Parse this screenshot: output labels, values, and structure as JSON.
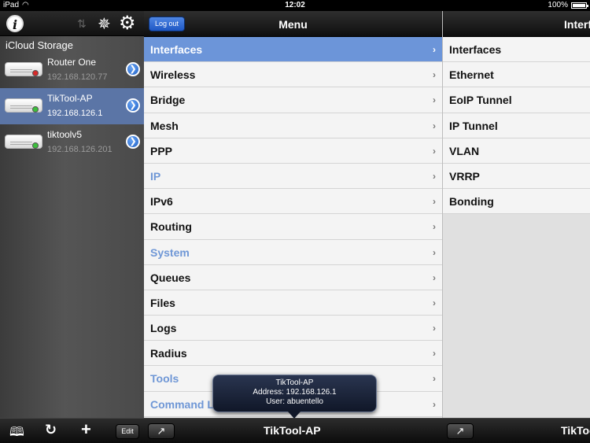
{
  "status": {
    "device": "iPad",
    "time": "12:02",
    "battery": "100%",
    "battery_level": 1.0
  },
  "sidebar": {
    "storage_label": "iCloud Storage",
    "devices": [
      {
        "name": "Router One",
        "ip": "192.168.120.77",
        "status": "offline"
      },
      {
        "name": "TikTool-AP",
        "ip": "192.168.126.1",
        "status": "online",
        "selected": true
      },
      {
        "name": "tiktoolv5",
        "ip": "192.168.126.201",
        "status": "online"
      }
    ]
  },
  "menu": {
    "logout_label": "Log out",
    "title": "Menu",
    "items": [
      {
        "label": "Interfaces",
        "style": "active"
      },
      {
        "label": "Wireless",
        "style": "normal"
      },
      {
        "label": "Bridge",
        "style": "normal"
      },
      {
        "label": "Mesh",
        "style": "normal"
      },
      {
        "label": "PPP",
        "style": "normal"
      },
      {
        "label": "IP",
        "style": "section"
      },
      {
        "label": "IPv6",
        "style": "normal"
      },
      {
        "label": "Routing",
        "style": "normal"
      },
      {
        "label": "System",
        "style": "section"
      },
      {
        "label": "Queues",
        "style": "normal"
      },
      {
        "label": "Files",
        "style": "normal"
      },
      {
        "label": "Logs",
        "style": "normal"
      },
      {
        "label": "Radius",
        "style": "normal"
      },
      {
        "label": "Tools",
        "style": "section"
      },
      {
        "label": "Command Line",
        "style": "section"
      }
    ]
  },
  "submenu": {
    "title": "Interfaces",
    "items": [
      "Interfaces",
      "Ethernet",
      "EoIP Tunnel",
      "IP Tunnel",
      "VLAN",
      "VRRP",
      "Bonding"
    ]
  },
  "toolbar": {
    "edit_label": "Edit",
    "title": "TikTool-AP",
    "right_title": "TikTool-AP"
  },
  "popover": {
    "name": "TikTool-AP",
    "address": "Address: 192.168.126.1",
    "user": "User: abuentello"
  },
  "colors": {
    "accent_blue": "#6c95d9",
    "section_text": "#6f97d6",
    "selected_row": "#5b75a6",
    "led_offline": "#d62a2a",
    "led_online": "#3cbf3c"
  },
  "icons": {
    "info": "info-icon",
    "sort": "sort-arrows-icon",
    "sun": "brightness-icon",
    "gear": "gear-icon",
    "book": "book-icon",
    "refresh": "refresh-icon",
    "plus": "plus-icon",
    "share": "share-icon",
    "chevron": "chevron-right-icon",
    "disclosure": "disclosure-arrow-icon"
  }
}
